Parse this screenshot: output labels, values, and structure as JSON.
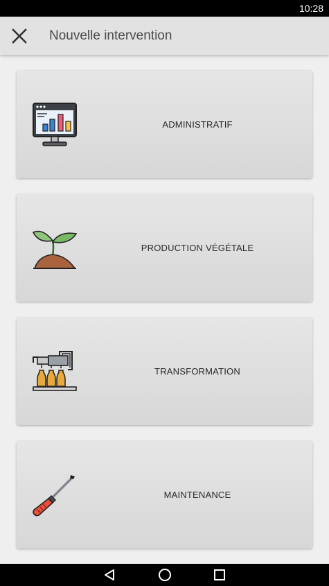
{
  "status_bar": {
    "time": "10:28"
  },
  "app_bar": {
    "title": "Nouvelle intervention",
    "close_icon": "close-icon"
  },
  "cards": [
    {
      "label": "ADMINISTRATIF",
      "icon": "computer-chart-icon"
    },
    {
      "label": "PRODUCTION VÉGÉTALE",
      "icon": "plant-sprout-icon"
    },
    {
      "label": "TRANSFORMATION",
      "icon": "bottling-machine-icon"
    },
    {
      "label": "MAINTENANCE",
      "icon": "screwdriver-icon"
    }
  ],
  "nav_bar": {
    "back_icon": "back-triangle-icon",
    "home_icon": "home-circle-icon",
    "recents_icon": "recents-square-icon"
  },
  "colors": {
    "app_bar": "#e2e2e2",
    "background": "#efefef",
    "card": "#dedede",
    "text": "#2a2a2a"
  }
}
